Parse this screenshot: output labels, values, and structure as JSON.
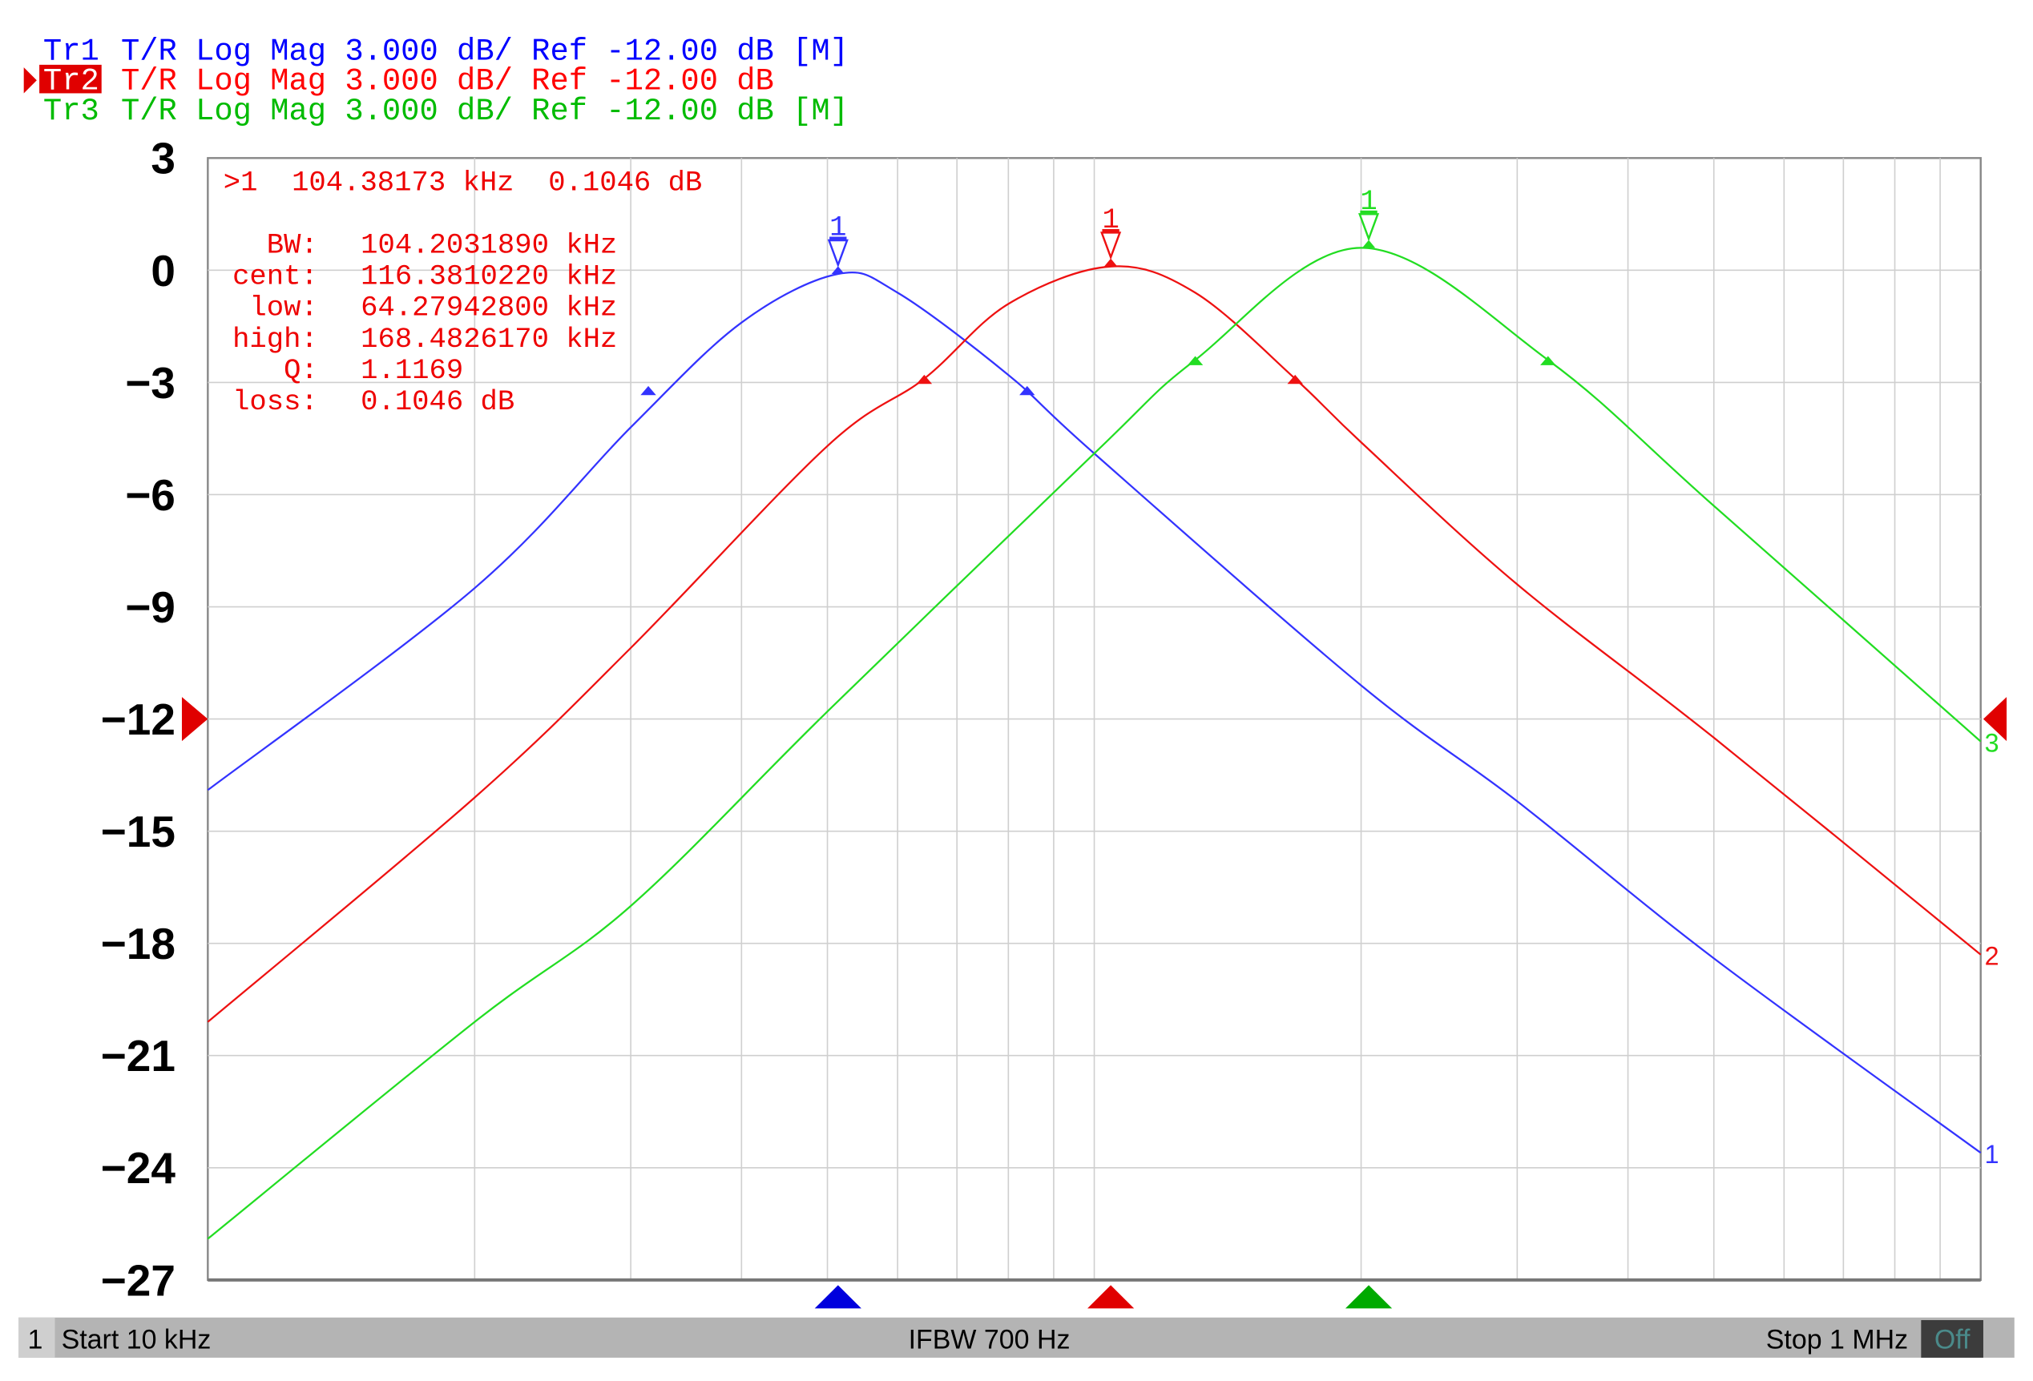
{
  "traces_header": [
    {
      "id": "Tr1",
      "text": "T/R Log Mag 3.000 dB/ Ref -12.00 dB [M]",
      "color": "#0000ff",
      "active": false
    },
    {
      "id": "Tr2",
      "text": "T/R Log Mag 3.000 dB/ Ref -12.00 dB",
      "color": "#ff0000",
      "active": true
    },
    {
      "id": "Tr3",
      "text": "T/R Log Mag 3.000 dB/ Ref -12.00 dB [M]",
      "color": "#00bb00",
      "active": false
    }
  ],
  "marker_readout": {
    "line1": ">1  104.38173 kHz  0.1046 dB",
    "rows": [
      {
        "label": "BW:",
        "value": "104.2031890 kHz"
      },
      {
        "label": "cent:",
        "value": "116.3810220 kHz"
      },
      {
        "label": "low:",
        "value": "64.27942800 kHz"
      },
      {
        "label": "high:",
        "value": "168.4826170 kHz"
      },
      {
        "label": "Q:",
        "value": "1.1169"
      },
      {
        "label": "loss:",
        "value": "0.1046 dB"
      }
    ]
  },
  "status_bar": {
    "channel": "1",
    "start": "Start 10 kHz",
    "ifbw": "IFBW 700 Hz",
    "stop": "Stop 1 MHz",
    "state": "Off"
  },
  "chart_data": {
    "type": "line",
    "xscale": "log",
    "xlim_khz": [
      10,
      1000
    ],
    "ylim": [
      -27,
      3
    ],
    "yticks": [
      3,
      0,
      -3,
      -6,
      -9,
      -12,
      -15,
      -18,
      -21,
      -24,
      -27
    ],
    "ytick_labels": [
      "3",
      "0",
      "−3",
      "−6",
      "−9",
      "−12",
      "−15",
      "−18",
      "−21",
      "−24",
      "−27"
    ],
    "reference_db": -12,
    "grid": true,
    "series": [
      {
        "name": "Tr1",
        "end_label": "1",
        "marker_label": "1",
        "color": "#3333ff",
        "x_khz": [
          10,
          20,
          30,
          40,
          51.4,
          60,
          80,
          100,
          200,
          300,
          500,
          1000
        ],
        "y_db": [
          -13.9,
          -8.5,
          -4.2,
          -1.4,
          -0.1,
          -0.6,
          -2.8,
          -4.9,
          -11.1,
          -14.2,
          -18.4,
          -23.6
        ],
        "peak": [
          51.4,
          -0.1
        ],
        "bw_points": [
          [
            31.4,
            -3.2
          ],
          [
            84,
            -3.2
          ]
        ]
      },
      {
        "name": "Tr2",
        "end_label": "2",
        "marker_label": "1",
        "color": "#ee1111",
        "x_khz": [
          10,
          20,
          30,
          50,
          64.3,
          80,
          104.4,
          130,
          168.5,
          200,
          300,
          500,
          1000
        ],
        "y_db": [
          -20.1,
          -14.1,
          -10.1,
          -4.7,
          -2.9,
          -0.9,
          0.1,
          -0.6,
          -2.9,
          -4.6,
          -8.4,
          -12.5,
          -18.3
        ],
        "peak": [
          104.38,
          0.1046
        ],
        "bw_points": [
          [
            64.3,
            -2.9
          ],
          [
            168.5,
            -2.9
          ]
        ]
      },
      {
        "name": "Tr3",
        "end_label": "3",
        "marker_label": "1",
        "color": "#22dd22",
        "x_khz": [
          10,
          20,
          30,
          50,
          100,
          130,
          200,
          325,
          500,
          1000
        ],
        "y_db": [
          -25.9,
          -20.1,
          -17.0,
          -11.8,
          -4.9,
          -2.4,
          0.6,
          -2.4,
          -6.3,
          -12.6
        ],
        "peak": [
          204,
          0.6
        ],
        "bw_points": [
          [
            130,
            -2.4
          ],
          [
            325,
            -2.4
          ]
        ]
      }
    ]
  }
}
